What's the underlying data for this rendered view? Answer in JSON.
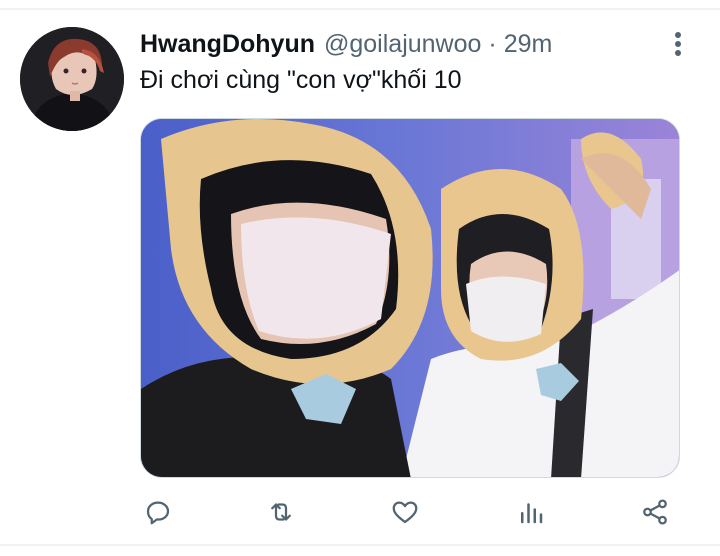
{
  "tweet": {
    "display_name": "HwangDohyun",
    "handle": "@goilajunwoo",
    "separator": "·",
    "time": "29m",
    "text": "Đi chơi cùng \"con vợ\"khối 10"
  },
  "media": {
    "alt": "Two people wearing plush bear hoodies and face masks taking a selfie"
  },
  "actions": {
    "reply": "reply-icon",
    "retweet": "retweet-icon",
    "like": "heart-icon",
    "views": "bar-chart-icon",
    "share": "share-icon"
  },
  "colors": {
    "text_primary": "#0f1419",
    "text_secondary": "#536471",
    "divider": "#eff3f4"
  }
}
